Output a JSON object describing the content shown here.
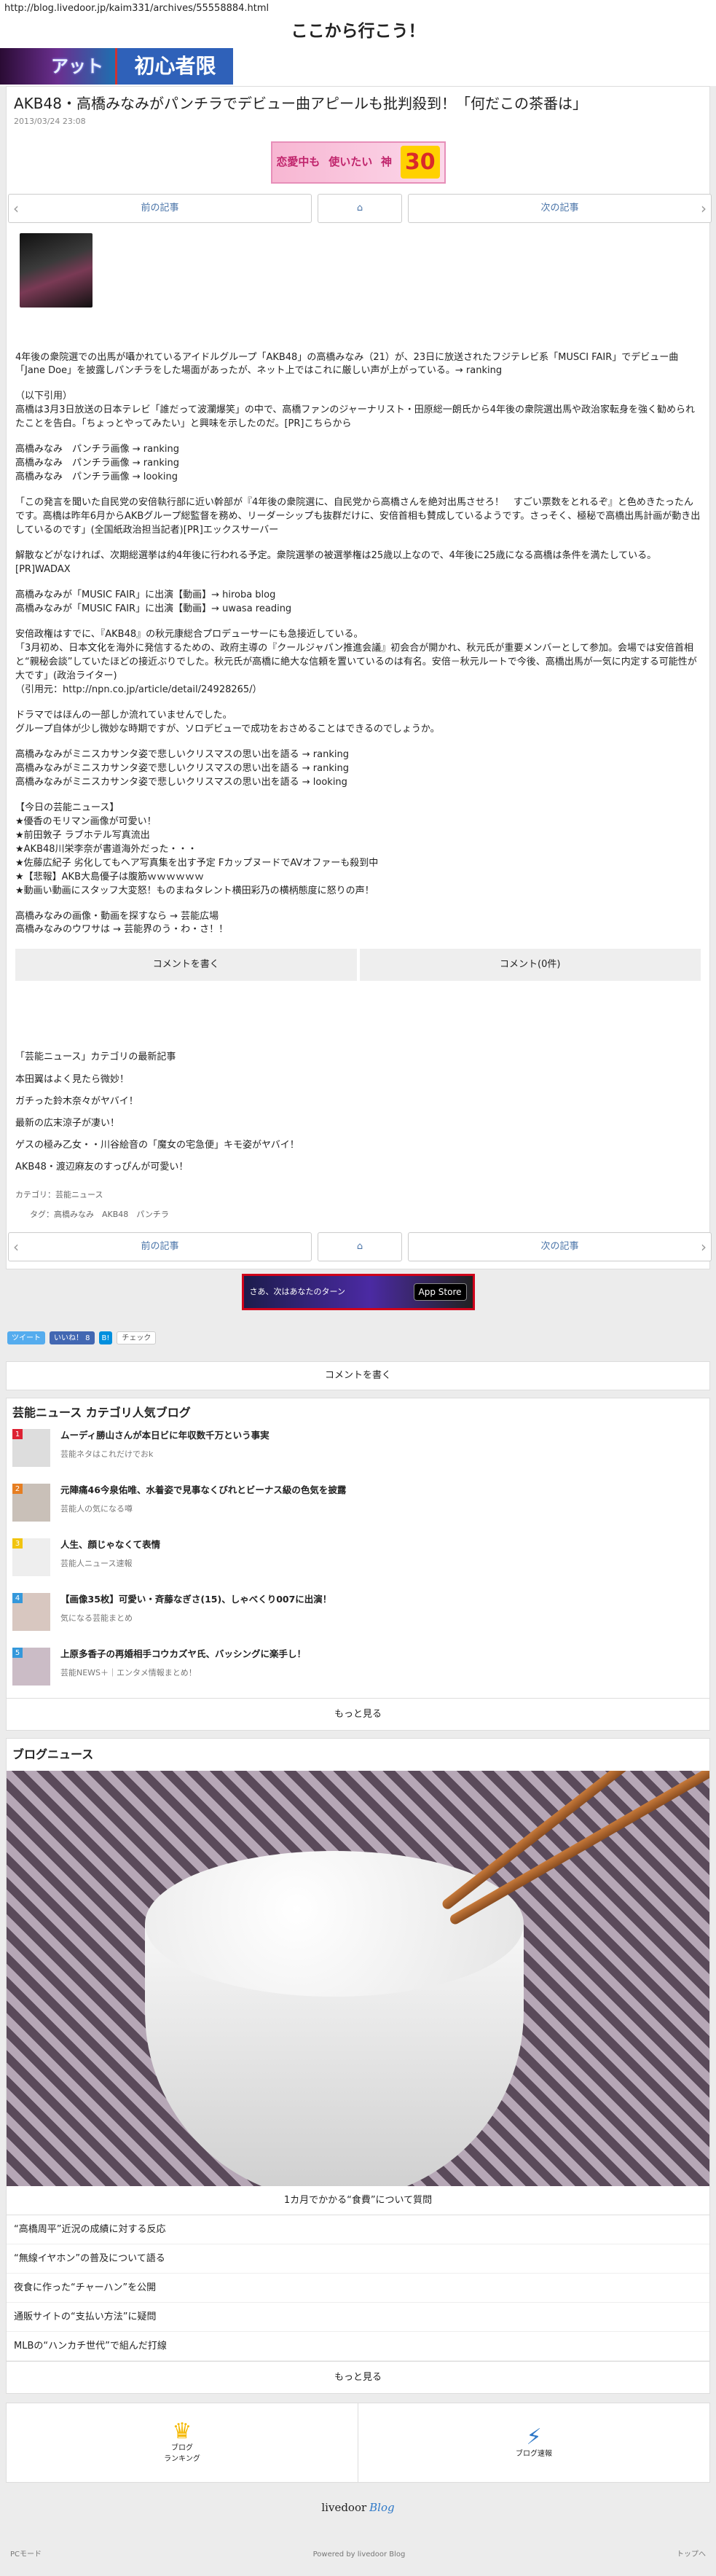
{
  "url": "http://blog.livedoor.jp/kaim331/archives/55558884.html",
  "blog_title": "ここから行こう！",
  "banner": {
    "left": "アット",
    "right": "初心者限"
  },
  "article": {
    "title": "AKB48・高橋みなみがパンチラでデビュー曲アピールも批判殺到！「何だこの茶番は」",
    "date": "2013/03/24 23:08",
    "ad": {
      "left": "恋愛中も",
      "mid": "使いたい",
      "big": "神",
      "num": "30"
    },
    "paragraphs": [
      "4年後の衆院選での出馬が囁かれているアイドルグループ「AKB48」の高橋みなみ（21）が、23日に放送されたフジテレビ系「MUSCI FAIR」でデビュー曲「Jane Doe」を披露しパンチラをした場面があったが、ネット上ではこれに厳しい声が上がっている。→ ranking",
      "（以下引用）\n高橋は3月3日放送の日本テレビ「誰だって波瀾爆笑」の中で、高橋ファンのジャーナリスト・田原総一朗氏から4年後の衆院選出馬や政治家転身を強く勧められたことを告白。「ちょっとやってみたい」と興味を示したのだ。[PR]こちらから",
      "高橋みなみ　パンチラ画像 → ranking\n高橋みなみ　パンチラ画像 → ranking\n高橋みなみ　パンチラ画像 → looking",
      "「この発言を聞いた自民党の安倍執行部に近い幹部が『4年後の衆院選に、自民党から高橋さんを絶対出馬させろ！　すごい票数をとれるぞ』と色めきたったんです。高橋は昨年6月からAKBグループ総監督を務め、リーダーシップも抜群だけに、安倍首相も賛成しているようです。さっそく、極秘で高橋出馬計画が動き出しているのです」(全国紙政治担当記者)[PR]エックスサーバー",
      "解散などがなければ、次期総選挙は約4年後に行われる予定。衆院選挙の被選挙権は25歳以上なので、4年後に25歳になる高橋は条件を満たしている。[PR]WADAX",
      "高橋みなみが「MUSIC FAIR」に出演【動画】→ hiroba blog\n高橋みなみが「MUSIC FAIR」に出演【動画】→ uwasa reading",
      "安倍政権はすでに、『AKB48』の秋元康総合プロデューサーにも急接近している。\n「3月初め、日本文化を海外に発信するための、政府主導の『クールジャパン推進会議』初会合が開かれ、秋元氏が重要メンバーとして参加。会場では安倍首相と“親秘会談”していたほどの接近ぶりでした。秋元氏が高橋に絶大な信頼を置いているのは有名。安倍－秋元ルートで今後、高橋出馬が一気に内定する可能性が大です」(政治ライター)\n（引用元：http://npn.co.jp/article/detail/24928265/）",
      "ドラマではほんの一部しか流れていませんでした。\nグループ自体が少し微妙な時期ですが、ソロデビューで成功をおさめることはできるのでしょうか。",
      "高橋みなみがミニスカサンタ姿で悲しいクリスマスの思い出を語る → ranking\n高橋みなみがミニスカサンタ姿で悲しいクリスマスの思い出を語る → ranking\n高橋みなみがミニスカサンタ姿で悲しいクリスマスの思い出を語る → looking",
      "【今日の芸能ニュース】\n★優香のモリマン画像が可愛い！\n★前田敦子 ラブホテル写真流出\n★AKB48川栄李奈が書道海外だった・・・\n★佐藤広紀子 劣化してもヘア写真集を出す予定 FカップヌードでAVオファーも殺到中\n★【悲報】AKB大島優子は腹筋ｗｗｗｗｗｗ\n★動画い動画にスタッフ大変怒！ものまねタレント横田彩乃の横柄態度に怒りの声！",
      "高橋みなみの画像・動画を探すなら → 芸能広場\n高橋みなみのウワサは → 芸能界のう・わ・さ！！"
    ],
    "comment_write": "コメントを書く",
    "comment_count": "コメント(0件)",
    "cat_heading": "「芸能ニュース」カテゴリの最新記事",
    "cat_items": [
      "本田翼はよく見たら微妙！",
      "ガチった鈴木奈々がヤバイ！",
      "最新の広末涼子が凄い！",
      "ゲスの極み乙女・・川谷絵音の「魔女の宅急便」キモ姿がヤバイ！",
      "AKB48・渡辺麻友のすっぴんが可愛い！"
    ],
    "category_label": "カテゴリ：",
    "category": "芸能ニュース",
    "tags_label": "タグ：",
    "tags": "高橋みなみ　AKB48　パンチラ"
  },
  "pager": {
    "prev": "前の記事",
    "next": "次の記事"
  },
  "ad2": {
    "text": "さあ、次はあなたのターン",
    "store": "App Store"
  },
  "social": {
    "tweet": "ツイート",
    "like": "いいね！ 8",
    "hatena": "B!",
    "check": "チェック"
  },
  "comment_write2": "コメントを書く",
  "ranking": {
    "title": "芸能ニュース カテゴリ人気ブログ",
    "items": [
      {
        "rank": "1",
        "title": "ムーディ勝山さんが本日ビに年収数千万という事実",
        "sub": "芸能ネタはこれだけでおk",
        "color": "#d23"
      },
      {
        "rank": "2",
        "title": "元陣痛46今泉佑唯、水着姿で見事なくびれとビーナス級の色気を披露",
        "sub": "芸能人の気になる噂",
        "color": "#e67e22"
      },
      {
        "rank": "3",
        "title": "人生、顔じゃなくて表情",
        "sub": "芸能人ニュース速報",
        "color": "#f1c40f"
      },
      {
        "rank": "4",
        "title": "【画像35枚】可愛い・斉藤なぎさ(15)、しゃべくり007に出演！",
        "sub": "気になる芸能まとめ",
        "color": "#3498db"
      },
      {
        "rank": "5",
        "title": "上原多香子の再婚相手コウカズヤ氏、バッシングに楽手し！",
        "sub": "芸能NEWS＋｜エンタメ情報まとめ！",
        "color": "#3498db"
      }
    ],
    "more": "もっと見る"
  },
  "blognews": {
    "title": "ブログニュース",
    "caption": "1カ月でかかる“食費”について質問",
    "items": [
      "“高橋周平”近況の成績に対する反応",
      "“無線イヤホン”の普及について語る",
      "夜食に作った“チャーハン”を公開",
      "通販サイトの“支払い方法”に疑問",
      "MLBの“ハンカチ世代”で組んだ打線"
    ],
    "more": "もっと見る"
  },
  "footer": {
    "ranking": "ブログ\nランキング",
    "ranking_icon": "crown-icon",
    "speed": "ブログ速報",
    "speed_icon": "lightning-icon",
    "logo1": "livedoor",
    "logo2": "Blog",
    "pc": "PCモード",
    "powered": "Powered by livedoor Blog",
    "top": "トップへ"
  }
}
